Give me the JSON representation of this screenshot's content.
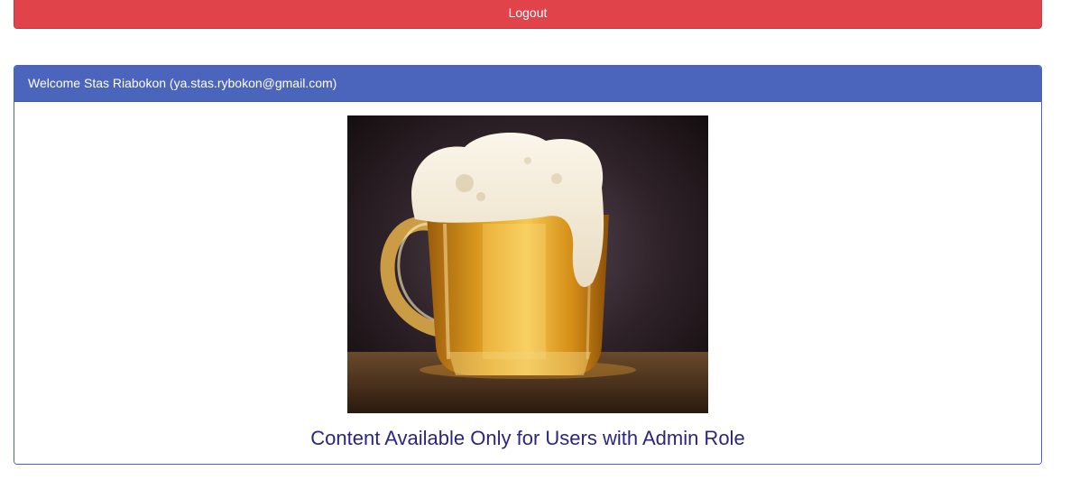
{
  "header": {
    "logout_label": "Logout",
    "colors": {
      "logout": "#e0434a",
      "panel_heading": "#4b64bc",
      "content_text": "#2a2680"
    }
  },
  "panel": {
    "welcome_text": "Welcome Stas Riabokon (ya.stas.rybokon@gmail.com)",
    "image_semantic": "beer-mug-photo",
    "admin_message": "Content Available Only for Users with Admin Role"
  }
}
